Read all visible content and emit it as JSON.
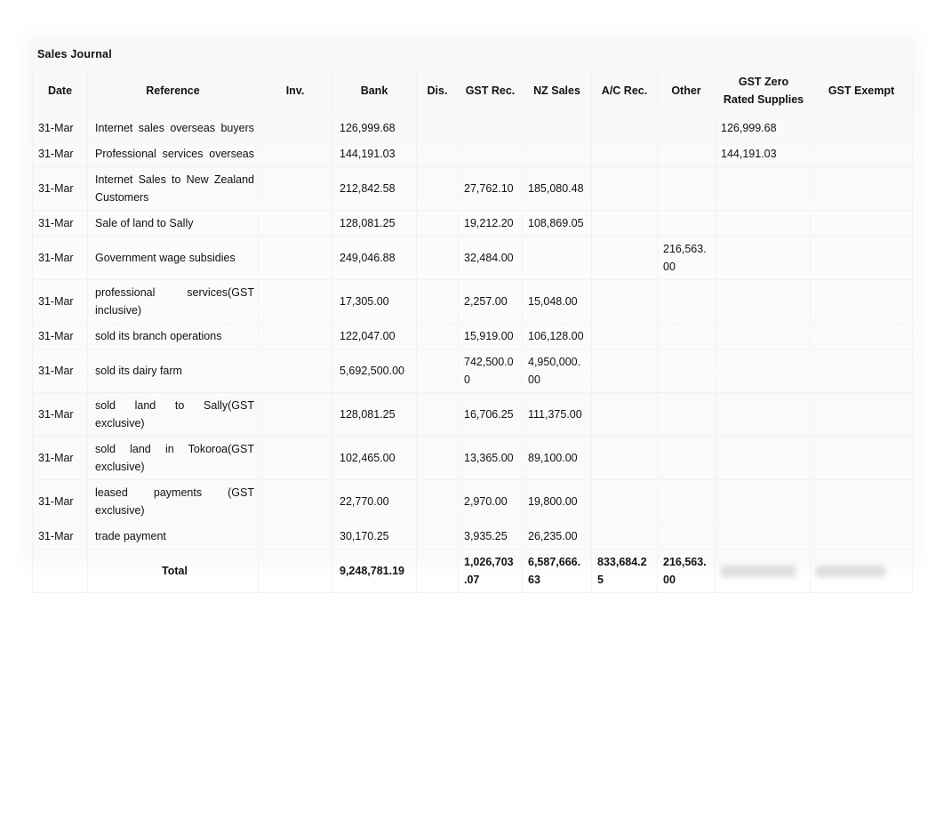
{
  "document": {
    "title": "Sales Journal"
  },
  "table": {
    "columns": [
      {
        "key": "date",
        "label": "Date"
      },
      {
        "key": "reference",
        "label": "Reference"
      },
      {
        "key": "inv",
        "label": "Inv."
      },
      {
        "key": "bank",
        "label": "Bank"
      },
      {
        "key": "dis",
        "label": "Dis."
      },
      {
        "key": "gst_rec",
        "label": "GST Rec."
      },
      {
        "key": "nz_sales",
        "label": "NZ Sales"
      },
      {
        "key": "ac_rec",
        "label": "A/C  Rec."
      },
      {
        "key": "other",
        "label": "Other"
      },
      {
        "key": "gst_zero",
        "label": "GST Zero Rated Supplies"
      },
      {
        "key": "gst_exempt",
        "label": "GST Exempt"
      }
    ],
    "rows": [
      {
        "date": "31-Mar",
        "reference": "Internet sales overseas buyers",
        "inv": "",
        "bank": "126,999.68",
        "dis": "",
        "gst_rec": "",
        "nz_sales": "",
        "ac_rec": "",
        "other": "",
        "gst_zero": "126,999.68",
        "gst_exempt": ""
      },
      {
        "date": "31-Mar",
        "reference": "Professional services overseas",
        "inv": "",
        "bank": "144,191.03",
        "dis": "",
        "gst_rec": "",
        "nz_sales": "",
        "ac_rec": "",
        "other": "",
        "gst_zero": "144,191.03",
        "gst_exempt": ""
      },
      {
        "date": "31-Mar",
        "reference": "Internet Sales to New Zealand Customers",
        "inv": "",
        "bank": "212,842.58",
        "dis": "",
        "gst_rec": "27,762.10",
        "nz_sales": "185,080.48",
        "ac_rec": "",
        "other": "",
        "gst_zero": "",
        "gst_exempt": ""
      },
      {
        "date": "31-Mar",
        "reference": "Sale of land to Sally",
        "inv": "",
        "bank": "128,081.25",
        "dis": "",
        "gst_rec": "19,212.20",
        "nz_sales": "108,869.05",
        "ac_rec": "",
        "other": "",
        "gst_zero": "",
        "gst_exempt": ""
      },
      {
        "date": "31-Mar",
        "reference": "Government wage subsidies",
        "inv": "",
        "bank": "249,046.88",
        "dis": "",
        "gst_rec": "32,484.00",
        "nz_sales": "",
        "ac_rec": "",
        "other": "216,563.00",
        "gst_zero": "",
        "gst_exempt": ""
      },
      {
        "date": "31-Mar",
        "reference": "professional services(GST inclusive)",
        "inv": "",
        "bank": "17,305.00",
        "dis": "",
        "gst_rec": "2,257.00",
        "nz_sales": "15,048.00",
        "ac_rec": "",
        "other": "",
        "gst_zero": "",
        "gst_exempt": ""
      },
      {
        "date": "31-Mar",
        "reference": "sold its branch operations",
        "inv": "",
        "bank": "122,047.00",
        "dis": "",
        "gst_rec": "15,919.00",
        "nz_sales": "106,128.00",
        "ac_rec": "",
        "other": "",
        "gst_zero": "",
        "gst_exempt": ""
      },
      {
        "date": "31-Mar",
        "reference": "sold its dairy farm",
        "inv": "",
        "bank": "5,692,500.00",
        "dis": "",
        "gst_rec": "742,500.00",
        "nz_sales": "4,950,000.00",
        "ac_rec": "",
        "other": "",
        "gst_zero": "",
        "gst_exempt": ""
      },
      {
        "date": "31-Mar",
        "reference": "sold land to Sally(GST exclusive)",
        "inv": "",
        "bank": "128,081.25",
        "dis": "",
        "gst_rec": "16,706.25",
        "nz_sales": "111,375.00",
        "ac_rec": "",
        "other": "",
        "gst_zero": "",
        "gst_exempt": ""
      },
      {
        "date": "31-Mar",
        "reference": "sold land in Tokoroa(GST exclusive)",
        "inv": "",
        "bank": "102,465.00",
        "dis": "",
        "gst_rec": "13,365.00",
        "nz_sales": "89,100.00",
        "ac_rec": "",
        "other": "",
        "gst_zero": "",
        "gst_exempt": ""
      },
      {
        "date": "31-Mar",
        "reference": " leased payments (GST exclusive)",
        "inv": "",
        "bank": "22,770.00",
        "dis": "",
        "gst_rec": "2,970.00",
        "nz_sales": "19,800.00",
        "ac_rec": "",
        "other": "",
        "gst_zero": "",
        "gst_exempt": ""
      },
      {
        "date": "31-Mar",
        "reference": " trade payment",
        "inv": "",
        "bank": "30,170.25",
        "dis": "",
        "gst_rec": "3,935.25",
        "nz_sales": "26,235.00",
        "ac_rec": "",
        "other": "",
        "gst_zero": "",
        "gst_exempt": ""
      }
    ],
    "total_row": {
      "label": "Total",
      "date": "",
      "inv": "",
      "bank": "9,248,781.19",
      "dis": "",
      "gst_rec": "1,026,703.07",
      "nz_sales": "6,587,666.63",
      "ac_rec": "833,684.25",
      "other": "216,563.00",
      "gst_zero": "",
      "gst_exempt": "",
      "gst_zero_redacted": true,
      "gst_exempt_redacted": true
    }
  }
}
